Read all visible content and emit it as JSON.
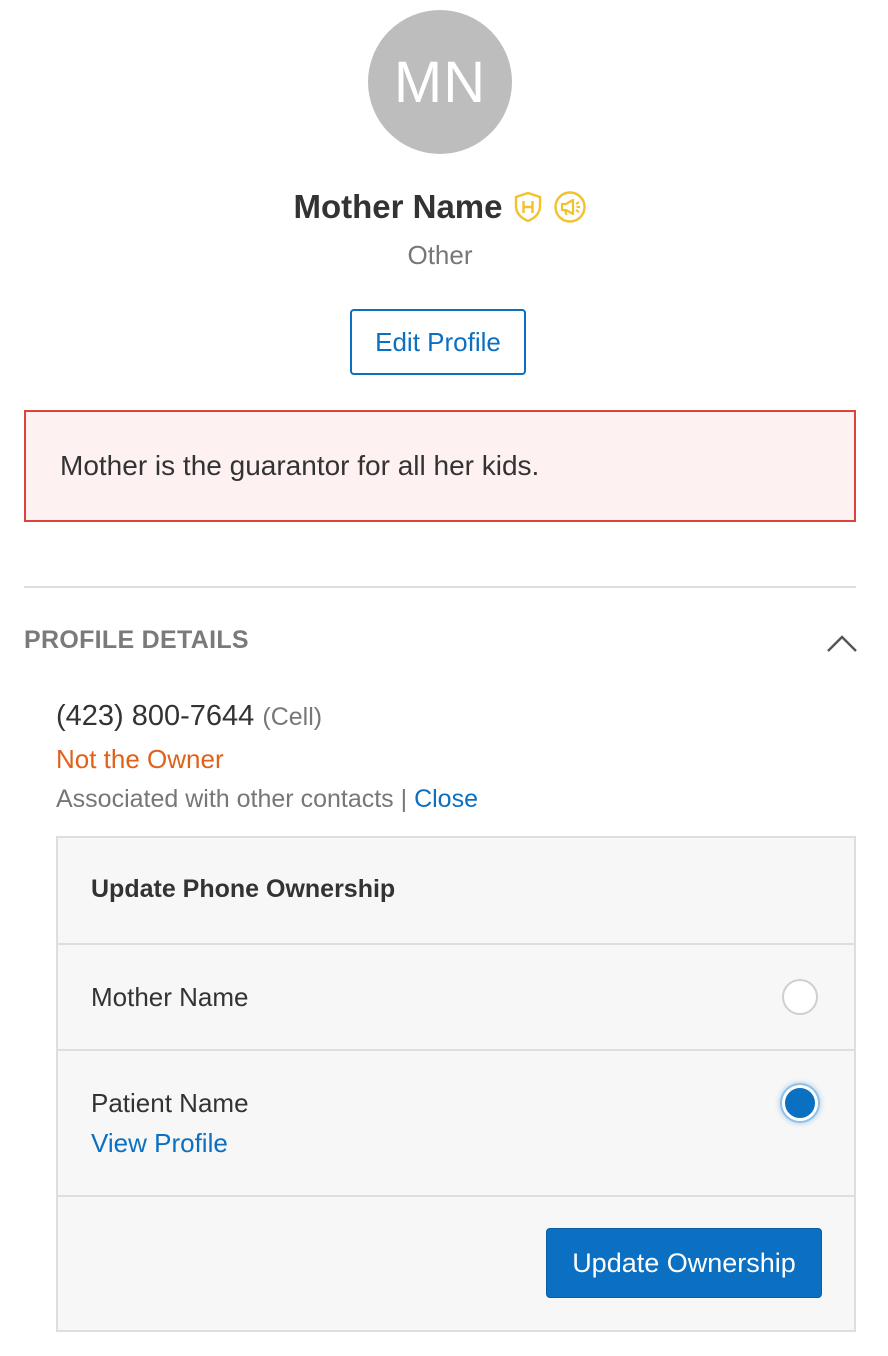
{
  "profile": {
    "initials": "MN",
    "name": "Mother Name",
    "relation": "Other",
    "edit_label": "Edit Profile",
    "badges": [
      "shield-h-icon",
      "megaphone-icon"
    ],
    "badge_color": "#f2c12e"
  },
  "alert": {
    "message": "Mother is the guarantor for all her kids."
  },
  "details": {
    "section_title": "PROFILE DETAILS",
    "phone_number": "(423) 800-7644",
    "phone_type": "(Cell)",
    "owner_status": "Not the Owner",
    "associated_text": "Associated with other contacts",
    "separator": "|",
    "close_label": "Close"
  },
  "ownership": {
    "title": "Update Phone Ownership",
    "options": [
      {
        "label": "Mother Name",
        "checked": false
      },
      {
        "label": "Patient Name",
        "link": "View Profile",
        "checked": true
      }
    ],
    "update_label": "Update Ownership"
  },
  "colors": {
    "accent": "#0b6fc2",
    "warning": "#e0611a",
    "alert_border": "#d9453c",
    "alert_bg": "#fdf2f1"
  }
}
